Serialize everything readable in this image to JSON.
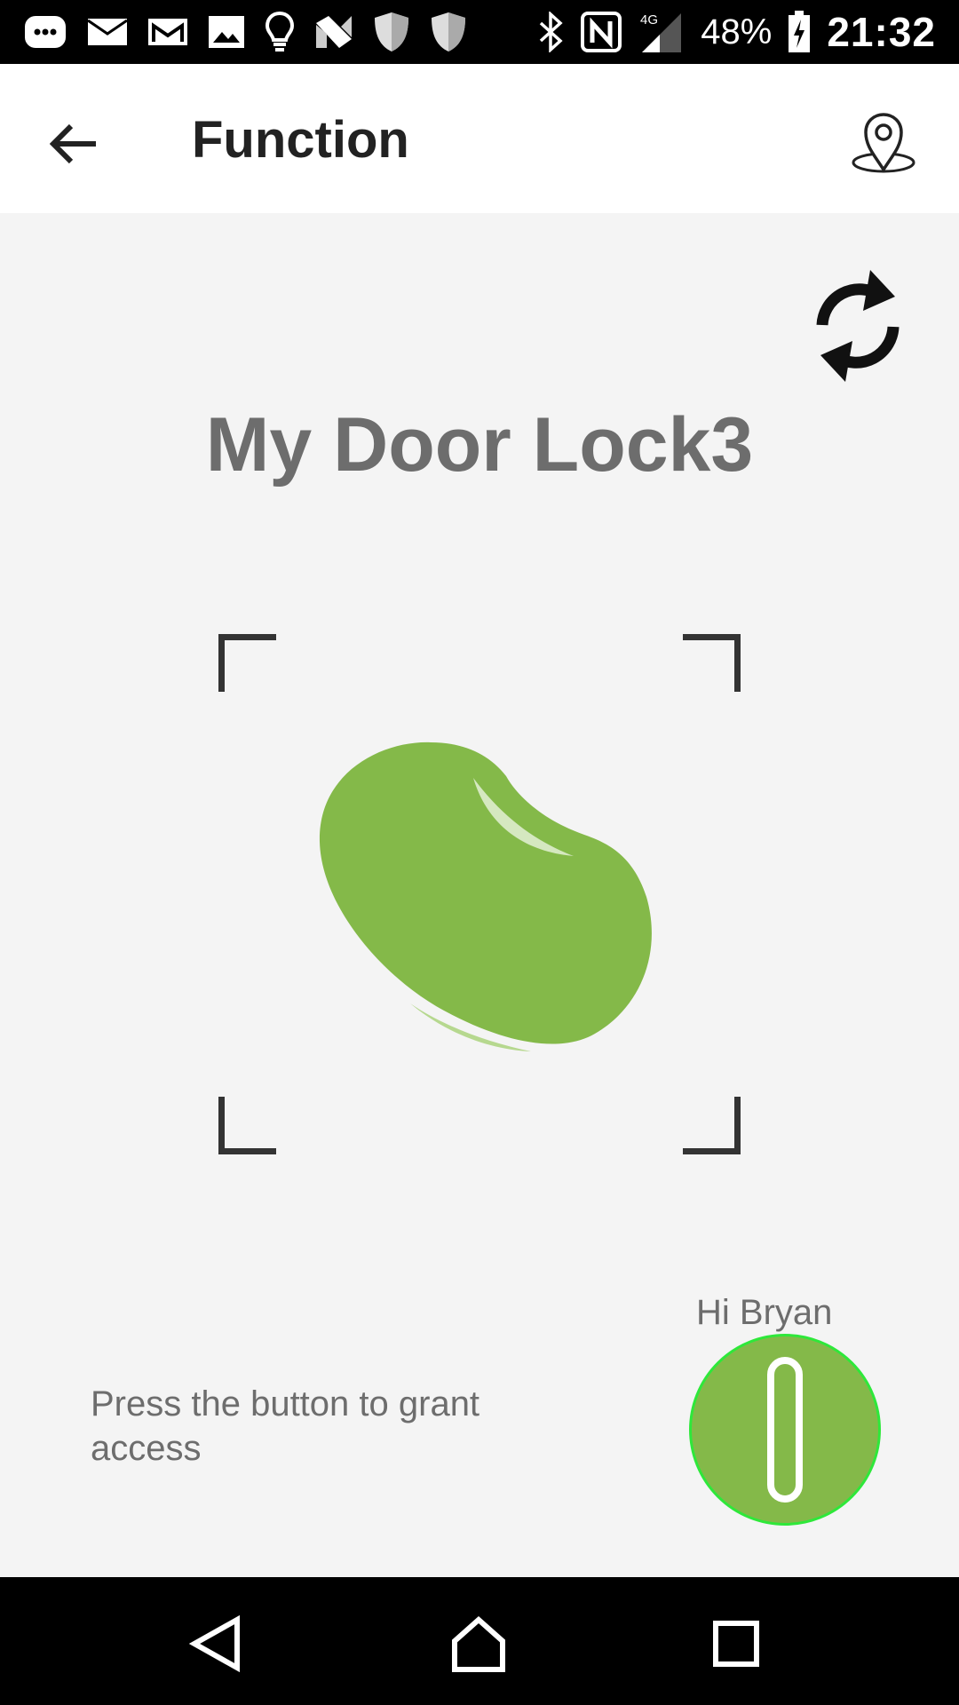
{
  "status_bar": {
    "battery": "48%",
    "time": "21:32",
    "network": "4G",
    "icons_left": [
      "messages-icon",
      "email-icon",
      "gmail-icon",
      "image-icon",
      "bulb-icon",
      "n-app-icon",
      "shield-icon",
      "shield-icon"
    ],
    "icons_right": [
      "bluetooth-icon",
      "nfc-icon",
      "signal-icon",
      "battery-charging-icon"
    ]
  },
  "app_bar": {
    "title": "Function",
    "back_icon": "arrow-left-icon",
    "location_icon": "map-pin-icon"
  },
  "content": {
    "device_name": "My Door Lock3",
    "greeting": "Hi Bryan",
    "hint": "Press the button to grant access",
    "refresh_icon": "refresh-icon",
    "bean_color": "#84b949",
    "button_color": "#84b949"
  },
  "nav_bar": {
    "back_icon": "triangle-back-icon",
    "home_icon": "home-icon",
    "recent_icon": "square-recents-icon"
  }
}
